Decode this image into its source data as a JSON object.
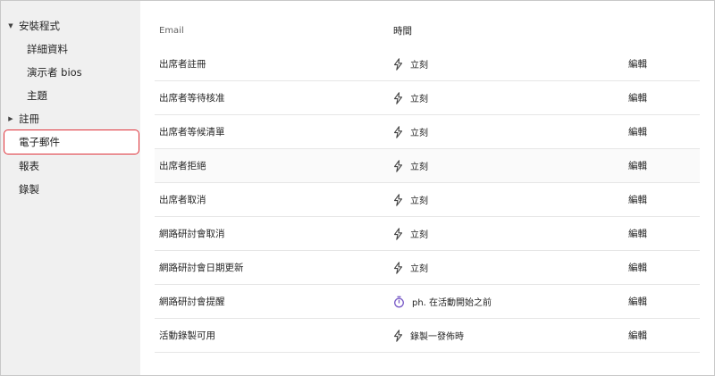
{
  "sidebar": {
    "items": [
      {
        "label": "安裝程式",
        "type": "group",
        "expanded": true
      },
      {
        "label": "詳細資料",
        "type": "sub"
      },
      {
        "label": "演示者 bios",
        "type": "sub"
      },
      {
        "label": "主題",
        "type": "sub"
      },
      {
        "label": "註冊",
        "type": "group",
        "expanded": false
      },
      {
        "label": "電子郵件",
        "type": "selected"
      },
      {
        "label": "報表",
        "type": "top"
      },
      {
        "label": "錄製",
        "type": "top"
      }
    ]
  },
  "table": {
    "headers": {
      "email": "Email",
      "time": "時間"
    },
    "rows": [
      {
        "name": "出席者註冊",
        "time": "立刻",
        "icon": "lightning-icon",
        "action": "編輯"
      },
      {
        "name": "出席者等待核准",
        "time": "立刻",
        "icon": "lightning-icon",
        "action": "編輯"
      },
      {
        "name": "出席者等候清單",
        "time": "立刻",
        "icon": "lightning-icon",
        "action": "編輯"
      },
      {
        "name": "出席者拒絕",
        "time": "立刻",
        "icon": "lightning-icon",
        "action": "編輯"
      },
      {
        "name": "出席者取消",
        "time": "立刻",
        "icon": "lightning-icon",
        "action": "編輯"
      },
      {
        "name": "網路研討會取消",
        "time": "立刻",
        "icon": "lightning-icon",
        "action": "編輯"
      },
      {
        "name": "網路研討會日期更新",
        "time": "立刻",
        "icon": "lightning-icon",
        "action": "編輯"
      },
      {
        "name": "網路研討會提醒",
        "time": "ph. 在活動開始之前",
        "icon": "timer-icon",
        "action": "編輯"
      },
      {
        "name": "活動錄製可用",
        "time": "錄製一發佈時",
        "icon": "lightning-icon",
        "action": "編輯"
      }
    ]
  },
  "colors": {
    "selected_border": "#e0323a",
    "timer_icon": "#7a5cc7"
  }
}
